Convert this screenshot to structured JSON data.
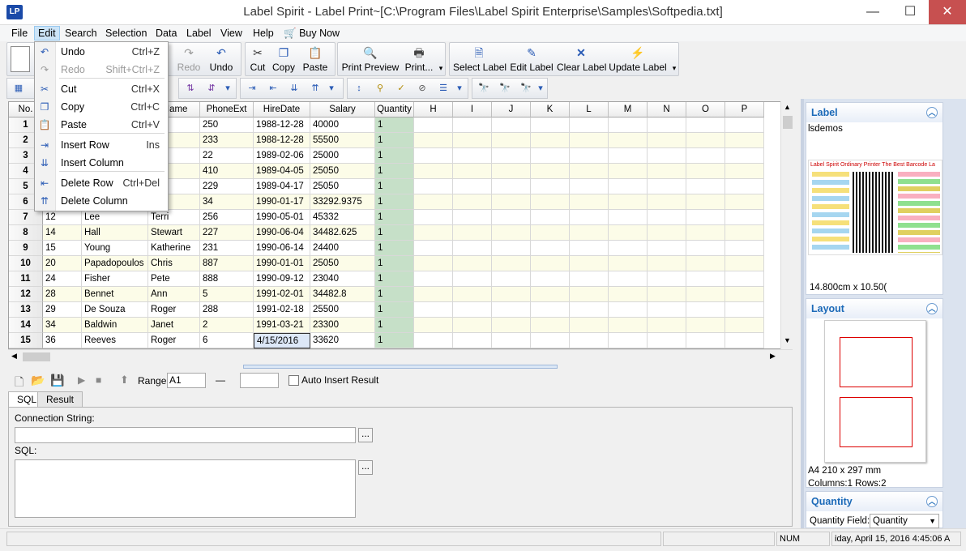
{
  "window": {
    "icon_text": "LP",
    "title": "Label Spirit - Label Print~[C:\\Program Files\\Label Spirit Enterprise\\Samples\\Softpedia.txt]",
    "minimize": "—",
    "maximize": "☐",
    "close": "✕"
  },
  "menu": {
    "items": [
      "File",
      "Edit",
      "Search",
      "Selection",
      "Data",
      "Label",
      "View",
      "Help",
      "Buy Now"
    ],
    "active": "Edit"
  },
  "toolbar": {
    "redo": "Redo",
    "undo": "Undo",
    "cut": "Cut",
    "copy": "Copy",
    "paste": "Paste",
    "print_preview": "Print Preview",
    "print": "Print...",
    "select_label": "Select Label",
    "edit_label": "Edit Label",
    "clear_label": "Clear Label",
    "update_label": "Update Label"
  },
  "edit_menu": {
    "items": [
      {
        "label": "Undo",
        "shortcut": "Ctrl+Z",
        "disabled": false,
        "icon": "undo-icon"
      },
      {
        "label": "Redo",
        "shortcut": "Shift+Ctrl+Z",
        "disabled": true,
        "icon": "redo-icon"
      },
      {
        "label": "Cut",
        "shortcut": "Ctrl+X",
        "disabled": false,
        "icon": "scissors-icon"
      },
      {
        "label": "Copy",
        "shortcut": "Ctrl+C",
        "disabled": false,
        "icon": "copy-icon"
      },
      {
        "label": "Paste",
        "shortcut": "Ctrl+V",
        "disabled": false,
        "icon": "paste-icon"
      },
      {
        "label": "Insert Row",
        "shortcut": "Ins",
        "disabled": false,
        "icon": "insert-row-icon"
      },
      {
        "label": "Insert Column",
        "shortcut": "",
        "disabled": false,
        "icon": "insert-column-icon"
      },
      {
        "label": "Delete Row",
        "shortcut": "Ctrl+Del",
        "disabled": false,
        "icon": "delete-row-icon"
      },
      {
        "label": "Delete Column",
        "shortcut": "",
        "disabled": false,
        "icon": "delete-column-icon"
      }
    ]
  },
  "grid": {
    "headers": [
      "No.",
      "",
      "",
      "tName",
      "PhoneExt",
      "HireDate",
      "Salary",
      "Quantity",
      "H",
      "I",
      "J",
      "K",
      "L",
      "M",
      "N",
      "O",
      "P"
    ],
    "rows": [
      {
        "no": "1",
        "c1": "",
        "c2": "",
        "c3": "erto",
        "phone": "250",
        "hire": "1988-12-28",
        "salary": "40000",
        "qty": "1"
      },
      {
        "no": "2",
        "c1": "",
        "c2": "",
        "c3": "e",
        "phone": "233",
        "hire": "1988-12-28",
        "salary": "55500",
        "qty": "1"
      },
      {
        "no": "3",
        "c1": "",
        "c2": "",
        "c3": "",
        "phone": "22",
        "hire": "1989-02-06",
        "salary": "25000",
        "qty": "1"
      },
      {
        "no": "4",
        "c1": "",
        "c2": "",
        "c3": "e",
        "phone": "410",
        "hire": "1989-04-05",
        "salary": "25050",
        "qty": "1"
      },
      {
        "no": "5",
        "c1": "",
        "c2": "",
        "c3": "",
        "phone": "229",
        "hire": "1989-04-17",
        "salary": "25050",
        "qty": "1"
      },
      {
        "no": "6",
        "c1": "",
        "c2": "",
        "c3": "",
        "phone": "34",
        "hire": "1990-01-17",
        "salary": "33292.9375",
        "qty": "1"
      },
      {
        "no": "7",
        "c1": "12",
        "c2": "Lee",
        "c3": "Terri",
        "phone": "256",
        "hire": "1990-05-01",
        "salary": "45332",
        "qty": "1"
      },
      {
        "no": "8",
        "c1": "14",
        "c2": "Hall",
        "c3": "Stewart",
        "phone": "227",
        "hire": "1990-06-04",
        "salary": "34482.625",
        "qty": "1"
      },
      {
        "no": "9",
        "c1": "15",
        "c2": "Young",
        "c3": "Katherine",
        "phone": "231",
        "hire": "1990-06-14",
        "salary": "24400",
        "qty": "1"
      },
      {
        "no": "10",
        "c1": "20",
        "c2": "Papadopoulos",
        "c3": "Chris",
        "phone": "887",
        "hire": "1990-01-01",
        "salary": "25050",
        "qty": "1"
      },
      {
        "no": "11",
        "c1": "24",
        "c2": "Fisher",
        "c3": "Pete",
        "phone": "888",
        "hire": "1990-09-12",
        "salary": "23040",
        "qty": "1"
      },
      {
        "no": "12",
        "c1": "28",
        "c2": "Bennet",
        "c3": "Ann",
        "phone": "5",
        "hire": "1991-02-01",
        "salary": "34482.8",
        "qty": "1"
      },
      {
        "no": "13",
        "c1": "29",
        "c2": "De Souza",
        "c3": "Roger",
        "phone": "288",
        "hire": "1991-02-18",
        "salary": "25500",
        "qty": "1"
      },
      {
        "no": "14",
        "c1": "34",
        "c2": "Baldwin",
        "c3": "Janet",
        "phone": "2",
        "hire": "1991-03-21",
        "salary": "23300",
        "qty": "1"
      },
      {
        "no": "15",
        "c1": "36",
        "c2": "Reeves",
        "c3": "Roger",
        "phone": "6",
        "hire": "4/15/2016",
        "salary": "33620",
        "qty": "1"
      }
    ]
  },
  "sql_toolbar": {
    "range_label": "Range:",
    "range_value": "A1",
    "range_dash": "—",
    "range_end": "",
    "auto_insert": "Auto Insert Result"
  },
  "tabs": [
    "SQL",
    "Result"
  ],
  "sql_panel": {
    "connection_label": "Connection String:",
    "connection_value": "",
    "sql_label": "SQL:",
    "sql_value": "",
    "browse_button": "..."
  },
  "right_panel": {
    "label_section": {
      "title": "Label",
      "name": "lsdemos",
      "size": "14.800cm x 10.50(",
      "preview_banner": "Label Spirit Ordinary Printer The Best Barcode La"
    },
    "layout_section": {
      "title": "Layout",
      "paper": "A4 210 x 297 mm",
      "grid": "Columns:1 Rows:2"
    },
    "quantity_section": {
      "title": "Quantity",
      "field_label": "Quantity Field:",
      "field_value": "Quantity"
    }
  },
  "status": {
    "num": "NUM",
    "datetime": "iday, April 15, 2016 4:45:06 A"
  },
  "colors": {
    "accent": "#1c6ab8",
    "qty_column": "#c6e0c8",
    "row_alt": "#fcfce8",
    "close_button": "#c75050"
  }
}
